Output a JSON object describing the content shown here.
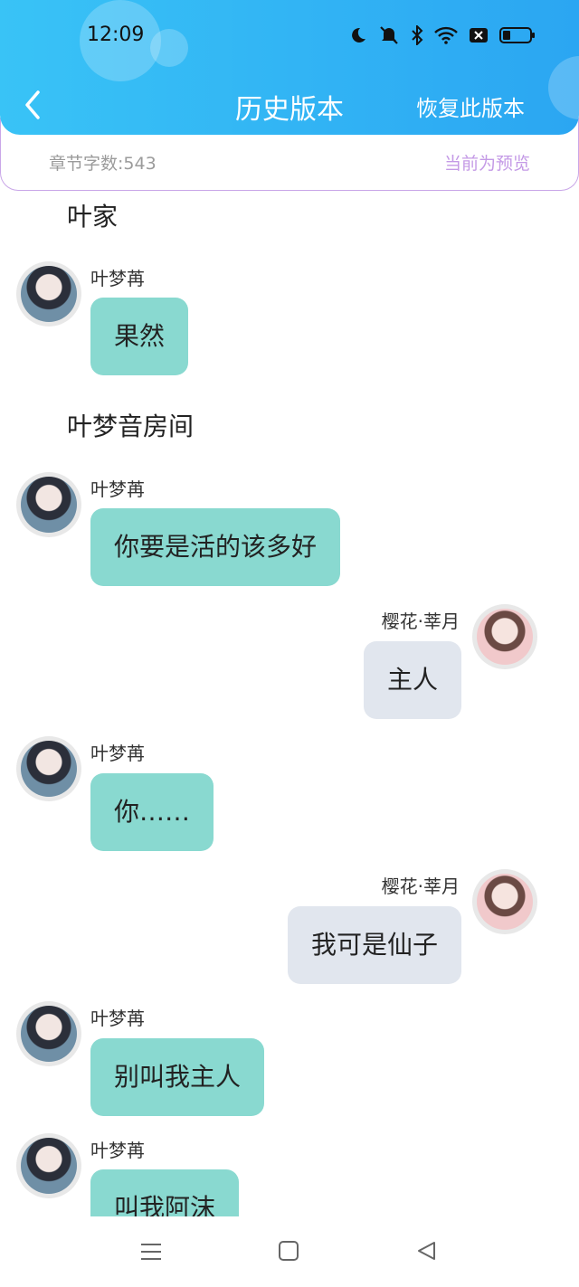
{
  "status_bar": {
    "time": "12:09"
  },
  "header": {
    "title": "历史版本",
    "restore_label": "恢复此版本"
  },
  "info_bar": {
    "word_count": "章节字数:543",
    "preview_label": "当前为预览"
  },
  "scenes": [
    "叶家",
    "叶梦音房间"
  ],
  "messages": [
    {
      "speaker": "叶梦苒",
      "text": "果然"
    },
    {
      "speaker": "叶梦苒",
      "text": "你要是活的该多好"
    },
    {
      "speaker": "樱花·莘月",
      "text": "主人"
    },
    {
      "speaker": "叶梦苒",
      "text": "你……"
    },
    {
      "speaker": "樱花·莘月",
      "text": "我可是仙子"
    },
    {
      "speaker": "叶梦苒",
      "text": "别叫我主人"
    },
    {
      "speaker": "叶梦苒",
      "text": "叫我阿沫"
    }
  ],
  "icons": {
    "back": "chevron-left-icon",
    "moon": "moon-icon",
    "mute": "bell-off-icon",
    "bluetooth": "bluetooth-icon",
    "wifi": "wifi-icon",
    "sim": "sim-off-icon",
    "battery": "battery-icon",
    "nav_menu": "menu-icon",
    "nav_home": "home-square-icon",
    "nav_back": "back-triangle-icon"
  },
  "colors": {
    "header": "#2ba6f2",
    "left_bubble": "#89d9d0",
    "right_bubble": "#e1e6ee",
    "preview_text": "#c49ae6",
    "infobar_border": "#c9a6e8"
  }
}
